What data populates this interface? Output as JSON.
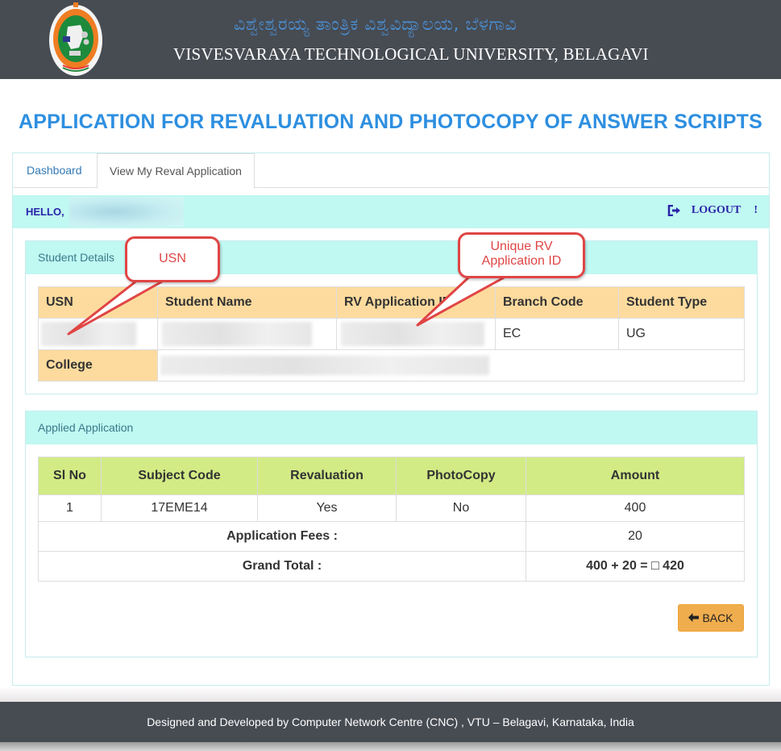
{
  "header": {
    "kannada_title": "ವಿಶ್ವೇಶ್ವರಯ್ಯ ತಾಂತ್ರಿಕ ವಿಶ್ವವಿದ್ಯಾಲಯ, ಬೆಳಗಾವಿ",
    "university_name": "VISVESVARAYA TECHNOLOGICAL UNIVERSITY, BELAGAVI",
    "logo_icon": "university-emblem-icon"
  },
  "page_title": "APPLICATION FOR REVALUATION AND PHOTOCOPY OF ANSWER SCRIPTS",
  "tabs": [
    {
      "label": "Dashboard",
      "active": false
    },
    {
      "label": "View My Reval Application",
      "active": true
    }
  ],
  "greeting": {
    "hello_label": "HELLO,",
    "user_name": "",
    "logout_label": "LOGOUT",
    "logout_suffix": "!",
    "logout_icon": "sign-out-icon"
  },
  "student_details": {
    "panel_title": "Student Details",
    "columns": [
      "USN",
      "Student Name",
      "RV Application ID",
      "Branch Code",
      "Student Type"
    ],
    "row": {
      "usn": "",
      "student_name": "",
      "rv_application_id": "",
      "branch_code": "EC",
      "student_type": "UG"
    },
    "college_label": "College",
    "college_value": ""
  },
  "applied_application": {
    "panel_title": "Applied Application",
    "columns": [
      "Sl No",
      "Subject Code",
      "Revaluation",
      "PhotoCopy",
      "Amount"
    ],
    "rows": [
      {
        "sl_no": "1",
        "subject_code": "17EME14",
        "revaluation": "Yes",
        "photocopy": "No",
        "amount": "400"
      }
    ],
    "application_fees_label": "Application Fees :",
    "application_fees_value": "20",
    "grand_total_label": "Grand Total :",
    "grand_total_value": "400 + 20 = □ 420"
  },
  "back_button": {
    "label": "BACK",
    "icon": "arrow-left-icon"
  },
  "annotations": {
    "usn_callout": "USN",
    "rvid_callout_line1": "Unique RV",
    "rvid_callout_line2": "Application ID"
  },
  "footer": {
    "text": "Designed and Developed by Computer Network Centre (CNC) , VTU – Belagavi, Karnataka, India"
  },
  "colors": {
    "header_bg": "#474b52",
    "title_blue": "#2e8fe0",
    "panel_head_bg": "#c0f8f2",
    "student_header_bg": "#fddb9e",
    "applied_header_bg": "#d2eb85",
    "back_button_bg": "#f0ad4e",
    "callout_red": "#e04545",
    "hello_text": "#2a24a8"
  }
}
